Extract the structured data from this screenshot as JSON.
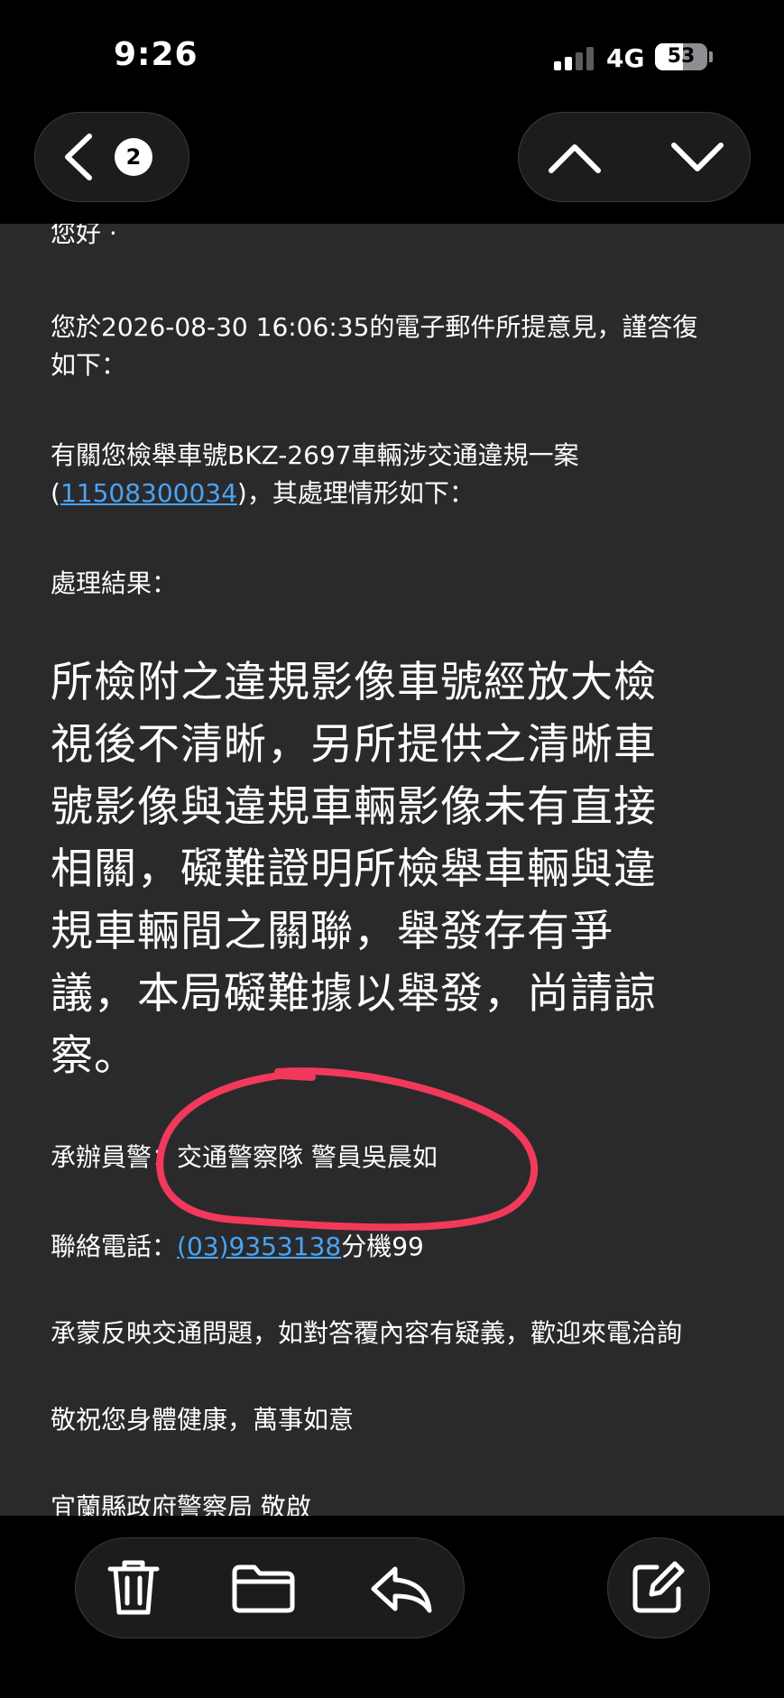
{
  "status_bar": {
    "time": "9:26",
    "network": "4G",
    "battery": "53",
    "battery_level": 0.53,
    "icons": [
      "signal-icon",
      "battery-icon"
    ]
  },
  "header": {
    "back_icon": "chevron-left-icon",
    "unread_count": "2",
    "prev_icon": "chevron-up-icon",
    "next_icon": "chevron-down-icon"
  },
  "email": {
    "greeting": "您好 ·",
    "intro_line1": "您於2026-08-30 16:06:35的電子郵件所提意見，謹答復",
    "intro_line2": "如下：",
    "case_line1": "有關您檢舉車號BKZ-2697車輛涉交通違規一案",
    "case_paren_open": "(",
    "case_number": "11508300034",
    "case_line2_rest": ")，其處理情形如下：",
    "result_label": "處理結果：",
    "result_lines": [
      "所檢附之違規影像車號經放大檢",
      "視後不清晰，另所提供之清晰車",
      "號影像與違規車輛影像未有直接",
      "相關，礙難證明所檢舉車輛與違",
      "規車輛間之關聯，舉發存有爭",
      "議，本局礙難據以舉發，尚請諒",
      "察。"
    ],
    "officer_label": "承辦員警：",
    "officer_name": "交通警察隊 警員吳晨如",
    "phone_label": "聯絡電話：",
    "phone_number": "(03)9353138",
    "phone_ext": "分機99",
    "closing_line": "承蒙反映交通問題，如對答覆內容有疑義，歡迎來電洽詢",
    "wish_line": "敬祝您身體健康，萬事如意",
    "signature": "宜蘭縣政府警察局 敬啟"
  },
  "annotation": {
    "color": "#f2395b"
  },
  "toolbar": {
    "icons": [
      "trash-icon",
      "folder-icon",
      "reply-icon",
      "compose-icon"
    ]
  },
  "colors": {
    "background": "#2a2a2c",
    "bars": "#000000",
    "link": "#4ba3f2",
    "text": "#ffffff"
  }
}
